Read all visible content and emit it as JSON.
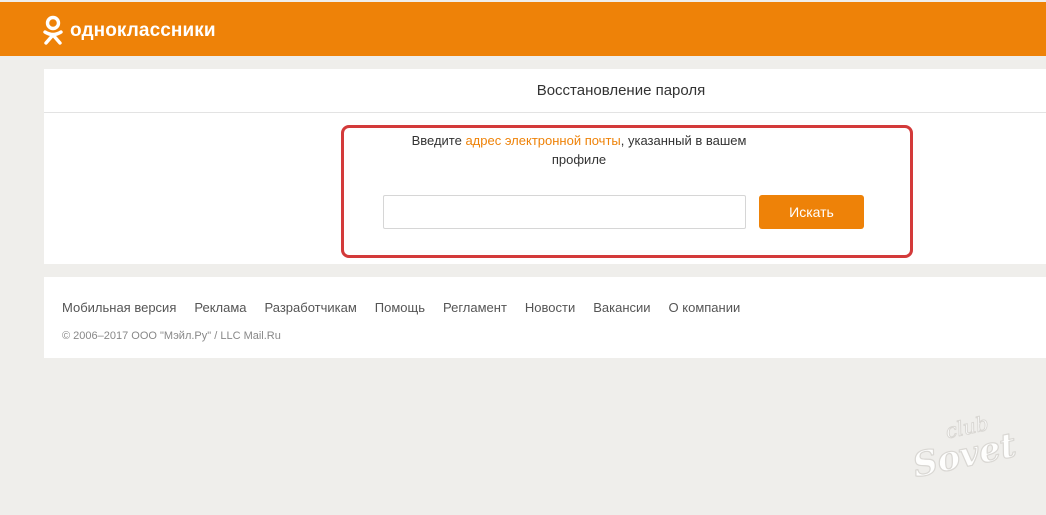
{
  "header": {
    "logo_text": "одноклассники",
    "logo_icon": "ok-icon",
    "brand_color": "#ee8208"
  },
  "recovery": {
    "title": "Восстановление пароля",
    "prompt_before": "Введите ",
    "prompt_link": "адрес электронной почты",
    "prompt_after": ", указанный в вашем профиле",
    "email_value": "",
    "search_label": "Искать",
    "highlight_color": "#d33a3a"
  },
  "footer": {
    "links": [
      "Мобильная версия",
      "Реклама",
      "Разработчикам",
      "Помощь",
      "Регламент",
      "Новости",
      "Вакансии",
      "О компании"
    ],
    "copyright": "© 2006–2017 ООО \"Мэйл.Ру\" / LLC Mail.Ru"
  },
  "watermark": {
    "text": "clubSovet"
  }
}
